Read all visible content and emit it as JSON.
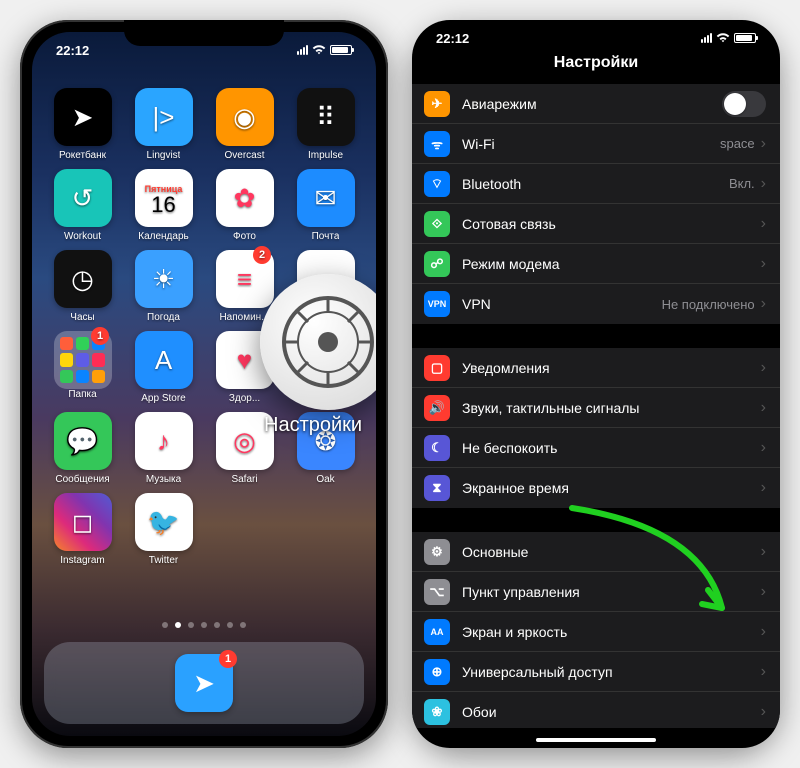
{
  "status": {
    "time": "22:12"
  },
  "home": {
    "apps": [
      {
        "label": "Рокетбанк",
        "bg": "#000000",
        "glyph": "➤"
      },
      {
        "label": "Lingvist",
        "bg": "#2aa5ff",
        "glyph": "|>"
      },
      {
        "label": "Overcast",
        "bg": "#ff9500",
        "glyph": "◉"
      },
      {
        "label": "Impulse",
        "bg": "#111111",
        "glyph": "⠿"
      },
      {
        "label": "Workout",
        "bg": "#18c5b8",
        "glyph": "↺"
      },
      {
        "label": "Календарь",
        "bg": "calendar",
        "day": "16",
        "dayname": "Пятница"
      },
      {
        "label": "Фото",
        "bg": "#ffffff",
        "glyph": "✿"
      },
      {
        "label": "Почта",
        "bg": "#1d8cff",
        "glyph": "✉"
      },
      {
        "label": "Часы",
        "bg": "#111111",
        "glyph": "◷"
      },
      {
        "label": "Погода",
        "bg": "#3aa0ff",
        "glyph": "☀"
      },
      {
        "label": "Напомин...",
        "bg": "#ffffff",
        "glyph": "≡",
        "badge": "2"
      },
      {
        "label": "",
        "bg": "#ffffff",
        "glyph": ""
      },
      {
        "label": "Папка",
        "bg": "folder",
        "badge": "1"
      },
      {
        "label": "App Store",
        "bg": "#1f8fff",
        "glyph": "A"
      },
      {
        "label": "Здор...",
        "bg": "#ffffff",
        "glyph": "♥"
      },
      {
        "label": "Настройки",
        "bg": "#8e8e93",
        "glyph": "⚙"
      },
      {
        "label": "Сообщения",
        "bg": "#34c759",
        "glyph": "💬"
      },
      {
        "label": "Музыка",
        "bg": "#ffffff",
        "glyph": "♪"
      },
      {
        "label": "Safari",
        "bg": "#ffffff",
        "glyph": "◎"
      },
      {
        "label": "Oak",
        "bg": "#3a86ff",
        "glyph": "❂"
      },
      {
        "label": "Instagram",
        "bg": "linear-gradient(45deg,#f58529,#dd2a7b,#8134af,#515bd4)",
        "glyph": "◻"
      },
      {
        "label": "Twitter",
        "bg": "#ffffff",
        "glyph": "🐦"
      }
    ],
    "page_active": 1,
    "page_count": 7,
    "dock": [
      {
        "label": "Telegram",
        "bg": "#2aa1ff",
        "glyph": "➤",
        "badge": "1"
      }
    ],
    "magnify_label": "Настройки"
  },
  "settings": {
    "title": "Настройки",
    "groups": [
      [
        {
          "icon_bg": "#ff9500",
          "glyph": "✈",
          "label": "Авиарежим",
          "control": "toggle"
        },
        {
          "icon_bg": "#007aff",
          "glyph": "ᯤ",
          "label": "Wi-Fi",
          "value": "space"
        },
        {
          "icon_bg": "#007aff",
          "glyph": "⌔",
          "label": "Bluetooth",
          "value": "Вкл."
        },
        {
          "icon_bg": "#34c759",
          "glyph": "⟐",
          "label": "Сотовая связь"
        },
        {
          "icon_bg": "#34c759",
          "glyph": "☍",
          "label": "Режим модема"
        },
        {
          "icon_bg": "#007aff",
          "glyph": "VPN",
          "small": true,
          "label": "VPN",
          "value": "Не подключено"
        }
      ],
      [
        {
          "icon_bg": "#ff3b30",
          "glyph": "▢",
          "label": "Уведомления"
        },
        {
          "icon_bg": "#ff3b30",
          "glyph": "🔊",
          "label": "Звуки, тактильные сигналы"
        },
        {
          "icon_bg": "#5856d6",
          "glyph": "☾",
          "label": "Не беспокоить"
        },
        {
          "icon_bg": "#5856d6",
          "glyph": "⧗",
          "label": "Экранное время"
        }
      ],
      [
        {
          "icon_bg": "#8e8e93",
          "glyph": "⚙",
          "label": "Основные"
        },
        {
          "icon_bg": "#8e8e93",
          "glyph": "⌥",
          "label": "Пункт управления"
        },
        {
          "icon_bg": "#007aff",
          "glyph": "AA",
          "small": true,
          "label": "Экран и яркость"
        },
        {
          "icon_bg": "#007aff",
          "glyph": "⊕",
          "label": "Универсальный доступ"
        },
        {
          "icon_bg": "#2cc1e0",
          "glyph": "❀",
          "label": "Обои"
        }
      ]
    ]
  }
}
